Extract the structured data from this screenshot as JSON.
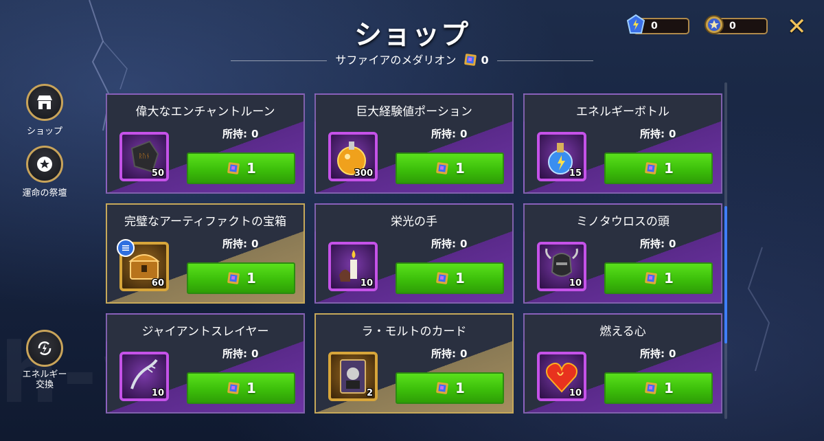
{
  "header": {
    "title": "ショップ",
    "subtitle": "サファイアのメダリオン",
    "medallion_count": "0"
  },
  "currencies": [
    {
      "icon": "energy-gem-icon",
      "value": "0"
    },
    {
      "icon": "star-medal-icon",
      "value": "0"
    }
  ],
  "close_icon": "×-close-icon",
  "close_glyph": "✕",
  "sidebar": {
    "shop_label": "ショップ",
    "altar_label": "運命の祭壇",
    "exchange_label": "エネルギー\n交換"
  },
  "owned_label": "所持:",
  "items": [
    {
      "name": "偉大なエンチャントルーン",
      "owned": "0",
      "qty": "50",
      "price": "1",
      "icon": "rune-icon",
      "frame": "purple"
    },
    {
      "name": "巨大経験値ポーション",
      "owned": "0",
      "qty": "300",
      "price": "1",
      "icon": "xp-potion-icon",
      "frame": "purple"
    },
    {
      "name": "エネルギーボトル",
      "owned": "0",
      "qty": "15",
      "price": "1",
      "icon": "energy-bottle-icon",
      "frame": "purple"
    },
    {
      "name": "完璧なアーティファクトの宝箱",
      "owned": "0",
      "qty": "60",
      "price": "1",
      "icon": "artifact-chest-icon",
      "frame": "gold"
    },
    {
      "name": "栄光の手",
      "owned": "0",
      "qty": "10",
      "price": "1",
      "icon": "hand-of-glory-icon",
      "frame": "purple"
    },
    {
      "name": "ミノタウロスの頭",
      "owned": "0",
      "qty": "10",
      "price": "1",
      "icon": "minotaur-head-icon",
      "frame": "purple"
    },
    {
      "name": "ジャイアントスレイヤー",
      "owned": "0",
      "qty": "10",
      "price": "1",
      "icon": "giant-slayer-icon",
      "frame": "purple"
    },
    {
      "name": "ラ・モルトのカード",
      "owned": "0",
      "qty": "2",
      "price": "1",
      "icon": "la-morte-card-icon",
      "frame": "gold"
    },
    {
      "name": "燃える心",
      "owned": "0",
      "qty": "10",
      "price": "1",
      "icon": "burning-heart-icon",
      "frame": "purple"
    }
  ],
  "watermark": "h-w.fun"
}
